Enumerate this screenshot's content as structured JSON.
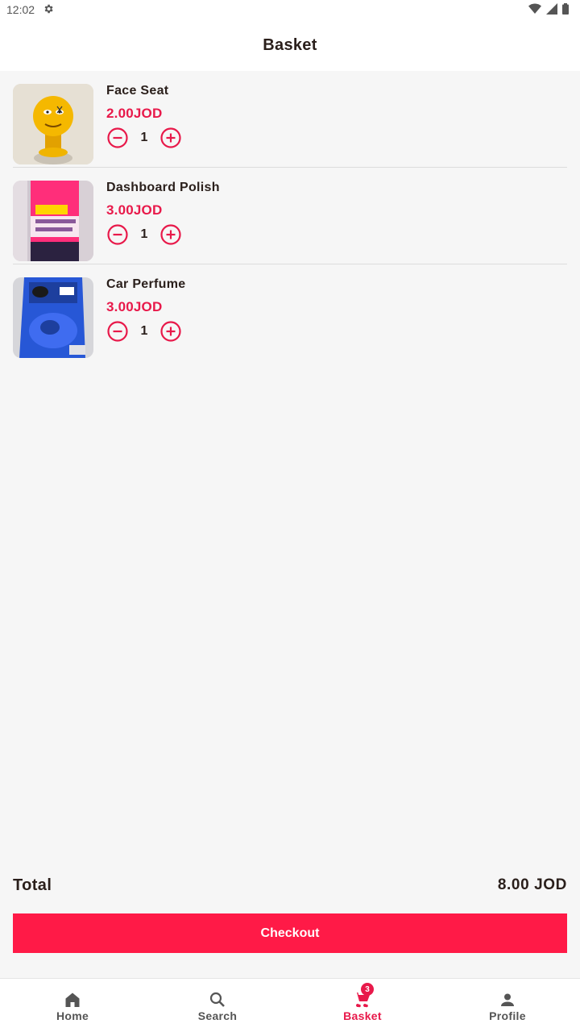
{
  "status_bar": {
    "time": "12:02",
    "settings_icon": "gear-icon",
    "wifi_icon": "wifi-icon",
    "signal_icon": "signal-icon",
    "battery_icon": "battery-icon"
  },
  "app_bar": {
    "title": "Basket"
  },
  "basket": {
    "items": [
      {
        "name": "Face Seat",
        "price": "2.00JOD",
        "quantity": "1",
        "image": "yellow-emoji-figure"
      },
      {
        "name": "Dashboard Polish",
        "price": "3.00JOD",
        "quantity": "1",
        "image": "pink-spray-can"
      },
      {
        "name": "Car Perfume",
        "price": "3.00JOD",
        "quantity": "1",
        "image": "blue-perfume-bag"
      }
    ]
  },
  "summary": {
    "total_label": "Total",
    "total_value": "8.00 JOD"
  },
  "checkout": {
    "label": "Checkout"
  },
  "bottom_nav": {
    "items": [
      {
        "label": "Home",
        "icon": "home-icon",
        "active": false
      },
      {
        "label": "Search",
        "icon": "search-icon",
        "active": false
      },
      {
        "label": "Basket",
        "icon": "cart-icon",
        "active": true,
        "badge": "3"
      },
      {
        "label": "Profile",
        "icon": "person-icon",
        "active": false
      }
    ]
  },
  "colors": {
    "accent": "#e8194a",
    "button": "#ff1a47",
    "background": "#f6f6f6",
    "text": "#2a1f1b"
  }
}
